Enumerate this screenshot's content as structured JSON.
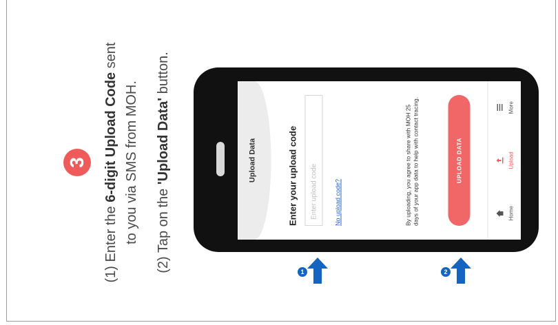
{
  "step": {
    "number": "3",
    "line1_pre": "(1) Enter the ",
    "line1_bold": "6-digit Upload Code",
    "line1_post": " sent",
    "line2": "to you via SMS from MOH.",
    "line3_pre": "(2) Tap on the ",
    "line3_bold": "'Upload Data'",
    "line3_post": " button."
  },
  "app": {
    "header_title": "Upload Data",
    "heading": "Enter your upload code",
    "input_placeholder": "Enter upload code",
    "input_value": "",
    "no_code_link": "No upload code?",
    "consent_text": "By uploading, you agree to share with MOH 25 days of your app data to help with contact tracing.",
    "upload_button": "UPLOAD DATA",
    "nav": [
      {
        "label": "Home",
        "icon": "home-icon",
        "active": false
      },
      {
        "label": "Upload",
        "icon": "upload-icon",
        "active": true
      },
      {
        "label": "More",
        "icon": "menu-icon",
        "active": false
      }
    ]
  },
  "pointers": [
    {
      "number": "1"
    },
    {
      "number": "2"
    }
  ],
  "colors": {
    "accent": "#ef5b5b",
    "pointer_blue": "#1565c0",
    "link": "#2764c9"
  }
}
